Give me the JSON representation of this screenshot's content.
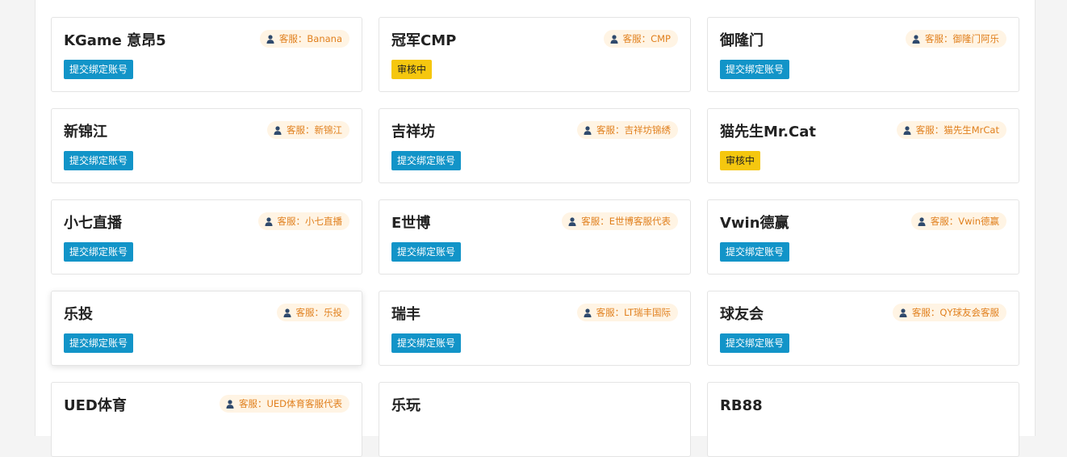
{
  "colors": {
    "submit_button": "#1294c8",
    "review_badge": "#f5c70f",
    "service_text": "#e07f1c",
    "service_bg": "#fff4e4"
  },
  "service_prefix": "客服：",
  "cards": [
    {
      "title": "KGame 意昂5",
      "service": "客服：Banana",
      "action": "提交绑定账号",
      "status": "submit"
    },
    {
      "title": "冠军CMP",
      "service": "客服：CMP",
      "action": "审核中",
      "status": "review"
    },
    {
      "title": "御隆门",
      "service": "客服：御隆门阿乐",
      "action": "提交绑定账号",
      "status": "submit"
    },
    {
      "title": "新锦江",
      "service": "客服：新锦江",
      "action": "提交绑定账号",
      "status": "submit"
    },
    {
      "title": "吉祥坊",
      "service": "客服：吉祥坊锦绣",
      "action": "提交绑定账号",
      "status": "submit"
    },
    {
      "title": "猫先生Mr.Cat",
      "service": "客服：猫先生MrCat",
      "action": "审核中",
      "status": "review"
    },
    {
      "title": "小七直播",
      "service": "客服：小七直播",
      "action": "提交绑定账号",
      "status": "submit"
    },
    {
      "title": "E世博",
      "service": "客服：E世博客服代表",
      "action": "提交绑定账号",
      "status": "submit"
    },
    {
      "title": "Vwin德赢",
      "service": "客服：Vwin德赢",
      "action": "提交绑定账号",
      "status": "submit"
    },
    {
      "title": "乐投",
      "service": "客服：乐投",
      "action": "提交绑定账号",
      "status": "submit"
    },
    {
      "title": "瑞丰",
      "service": "客服：LT瑞丰国际",
      "action": "提交绑定账号",
      "status": "submit"
    },
    {
      "title": "球友会",
      "service": "客服：QY球友会客服",
      "action": "提交绑定账号",
      "status": "submit"
    },
    {
      "title": "UED体育",
      "service": "客服：UED体育客服代表",
      "action": "",
      "status": "submit"
    },
    {
      "title": "乐玩",
      "service": "",
      "action": "",
      "status": "submit"
    },
    {
      "title": "RB88",
      "service": "",
      "action": "",
      "status": "submit"
    }
  ]
}
